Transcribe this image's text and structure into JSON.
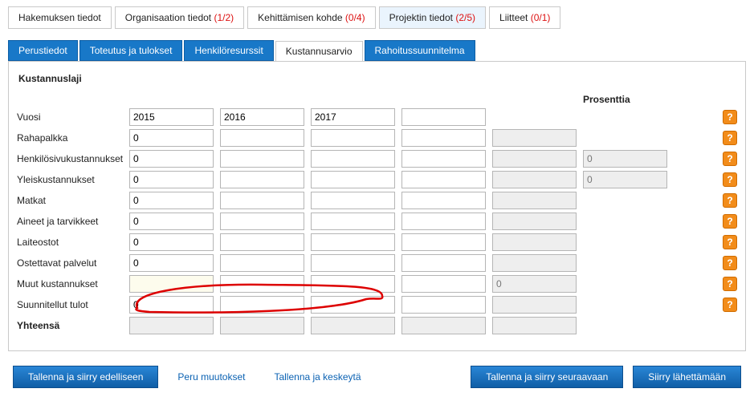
{
  "mainTabs": [
    {
      "label": "Hakemuksen tiedot",
      "count": ""
    },
    {
      "label": "Organisaation tiedot",
      "count": "(1/2)",
      "style": "red"
    },
    {
      "label": "Kehittämisen kohde",
      "count": "(0/4)",
      "style": "red"
    },
    {
      "label": "Projektin tiedot",
      "count": "(2/5)",
      "style": "red",
      "active": true
    },
    {
      "label": "Liitteet",
      "count": "(0/1)",
      "style": "red"
    }
  ],
  "subTabs": [
    {
      "label": "Perustiedot"
    },
    {
      "label": "Toteutus ja tulokset"
    },
    {
      "label": "Henkilöresurssit"
    },
    {
      "label": "Kustannusarvio",
      "active": true
    },
    {
      "label": "Rahoitussuunnitelma"
    }
  ],
  "panel": {
    "heading": "Kustannuslaji",
    "pctHeading": "Prosenttia",
    "years": {
      "label": "Vuosi",
      "c": [
        "2015",
        "2016",
        "2017",
        ""
      ]
    },
    "rows": [
      {
        "id": "rahapalkka",
        "label": "Rahapalkka",
        "c": [
          "0",
          "",
          "",
          ""
        ],
        "sum": "",
        "pct": null
      },
      {
        "id": "henkilosivu",
        "label": "Henkilösivukustannukset",
        "c": [
          "0",
          "",
          "",
          ""
        ],
        "sum": "",
        "pct": "0"
      },
      {
        "id": "yleis",
        "label": "Yleiskustannukset",
        "c": [
          "0",
          "",
          "",
          ""
        ],
        "sum": "",
        "pct": "0"
      },
      {
        "id": "matkat",
        "label": "Matkat",
        "c": [
          "0",
          "",
          "",
          ""
        ],
        "sum": "",
        "pct": null
      },
      {
        "id": "aineet",
        "label": "Aineet ja tarvikkeet",
        "c": [
          "0",
          "",
          "",
          ""
        ],
        "sum": "",
        "pct": null
      },
      {
        "id": "laite",
        "label": "Laiteostot",
        "c": [
          "0",
          "",
          "",
          ""
        ],
        "sum": "",
        "pct": null
      },
      {
        "id": "ostopalv",
        "label": "Ostettavat palvelut",
        "c": [
          "0",
          "",
          "",
          ""
        ],
        "sum": "",
        "pct": null
      },
      {
        "id": "muut",
        "label": "Muut kustannukset",
        "c": [
          "",
          "",
          "",
          ""
        ],
        "sum": "0",
        "pct": null,
        "highlight": true,
        "sumRO": true
      },
      {
        "id": "tulot",
        "label": "Suunnitellut tulot",
        "c": [
          "0",
          "",
          "",
          ""
        ],
        "sum": "",
        "pct": null
      }
    ],
    "total": {
      "label": "Yhteensä"
    }
  },
  "footer": {
    "prev": "Tallenna ja siirry edelliseen",
    "undo": "Peru muutokset",
    "pause": "Tallenna ja keskeytä",
    "next": "Tallenna ja siirry seuraavaan",
    "send": "Siirry lähettämään"
  },
  "helpGlyph": "?"
}
